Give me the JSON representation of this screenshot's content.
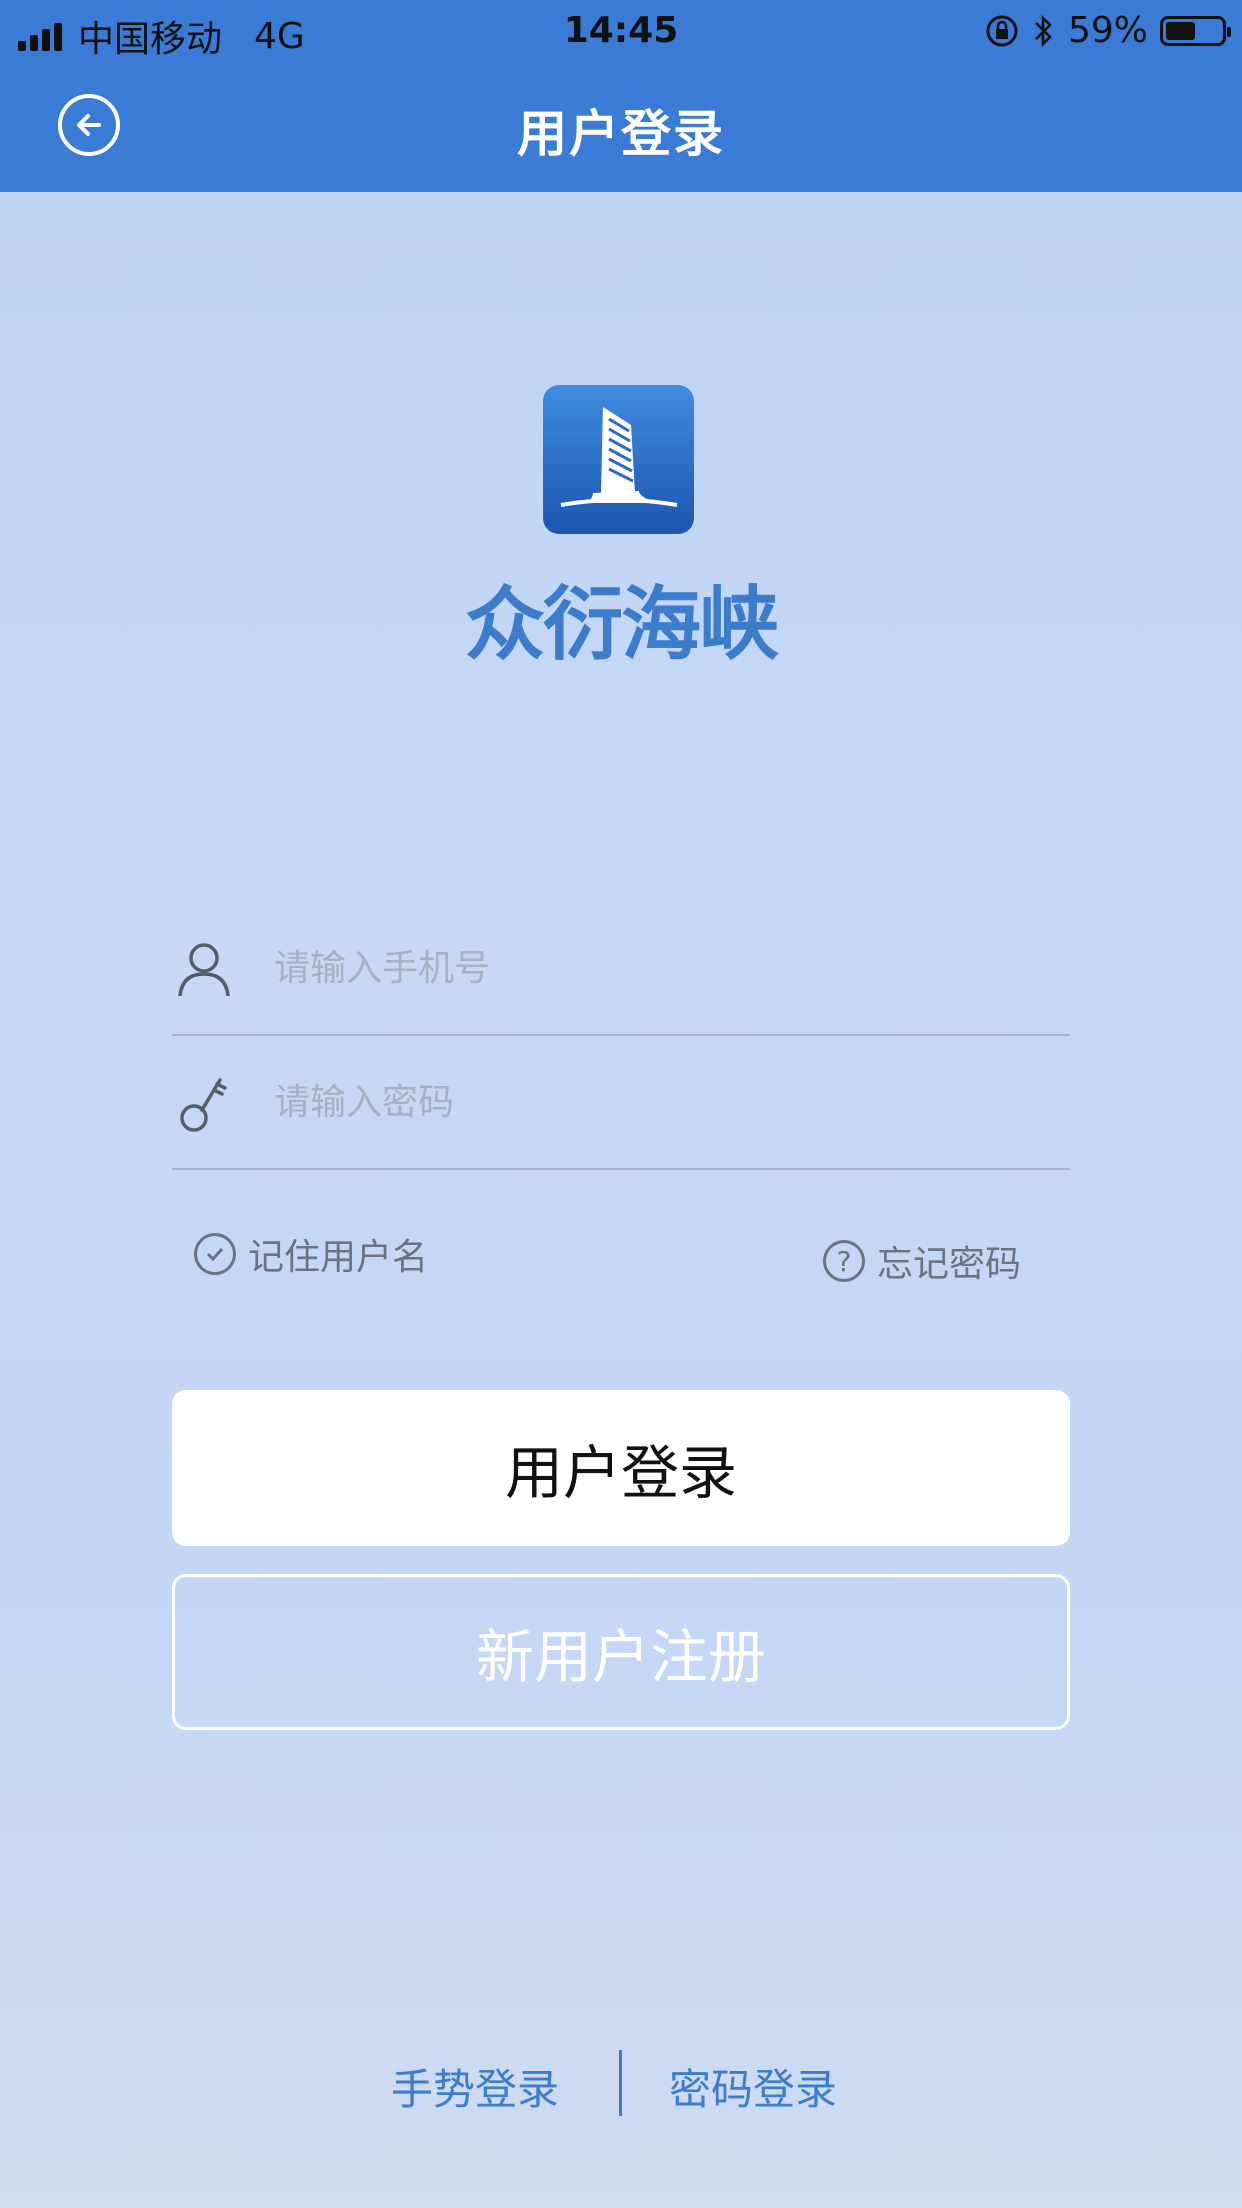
{
  "status_bar": {
    "carrier": "中国移动",
    "network": "4G",
    "time": "14:45",
    "battery_percent": "59%",
    "battery_level": 0.59,
    "icons": [
      "signal-icon",
      "rotation-lock-icon",
      "bluetooth-icon",
      "battery-icon"
    ]
  },
  "nav": {
    "title": "用户登录",
    "back_icon": "back-arrow-circle-icon"
  },
  "app": {
    "logo_icon": "building-logo-icon",
    "brand_name": "众衍海峡"
  },
  "form": {
    "phone_placeholder": "请输入手机号",
    "phone_value": "",
    "password_placeholder": "请输入密码",
    "password_value": "",
    "remember_label": "记住用户名",
    "forgot_label": "忘记密码"
  },
  "buttons": {
    "login_label": "用户登录",
    "register_label": "新用户注册"
  },
  "bottom": {
    "gesture_login": "手势登录",
    "password_login": "密码登录"
  },
  "colors": {
    "header_blue": "#3a7bd5",
    "link_blue": "#3b7ccd",
    "background": "#c4d7f5"
  }
}
